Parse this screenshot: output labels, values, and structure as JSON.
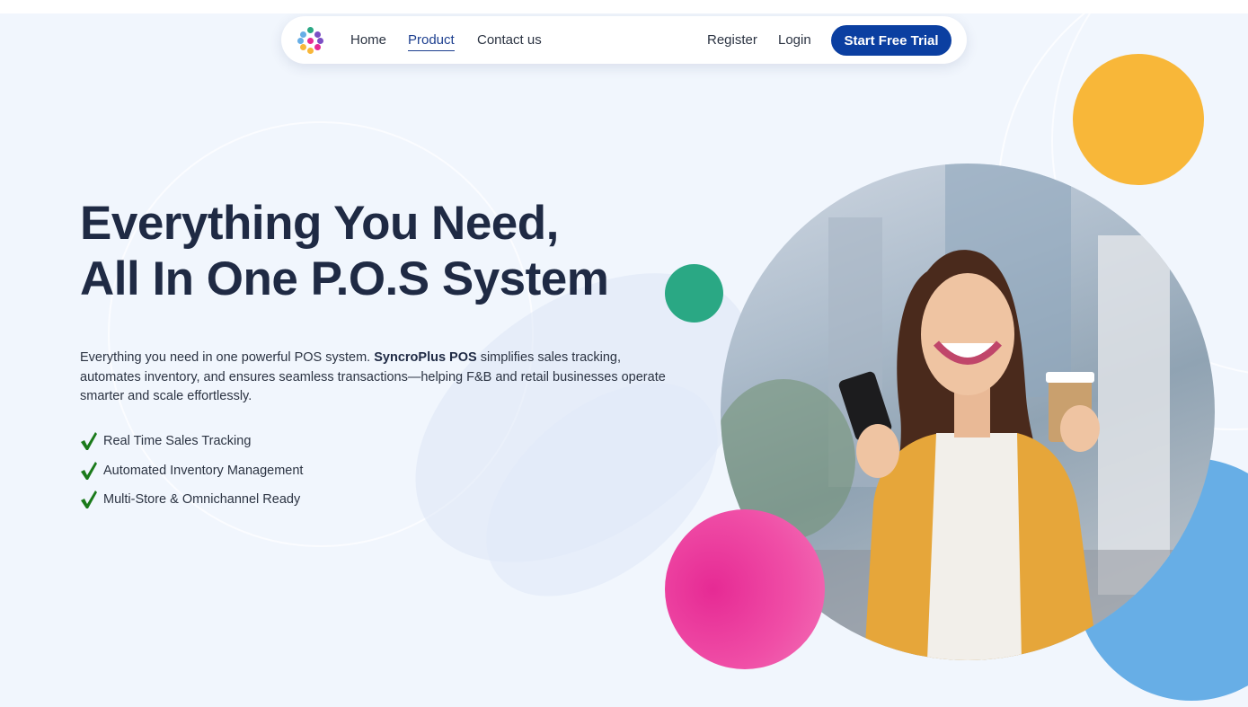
{
  "nav": {
    "links": [
      {
        "label": "Home"
      },
      {
        "label": "Product"
      },
      {
        "label": "Contact us"
      }
    ],
    "register_label": "Register",
    "login_label": "Login",
    "cta_label": "Start Free Trial"
  },
  "hero": {
    "headline_line1": "Everything You Need,",
    "headline_line2": "All In One P.O.S System",
    "description_prefix": "Everything you need in one powerful POS system. ",
    "description_brand": "SyncroPlus POS",
    "description_suffix": " simplifies sales tracking, automates inventory, and ensures seamless transactions—helping F&B and retail businesses operate smarter and scale effortlessly.",
    "features": [
      {
        "label": "Real Time Sales Tracking"
      },
      {
        "label": "Automated Inventory Management"
      },
      {
        "label": "Multi-Store & Omnichannel Ready"
      }
    ]
  },
  "colors": {
    "primary": "#0b3fa1",
    "heading": "#1f2a44",
    "check": "#1a7a1a",
    "accent_orange": "#f8b739",
    "accent_green": "#2aa884",
    "accent_pink": "#e62a94",
    "accent_blue": "#67aee6"
  },
  "icons": {
    "logo": "dots-logo-icon",
    "feature_bullet": "checkmark-icon"
  }
}
